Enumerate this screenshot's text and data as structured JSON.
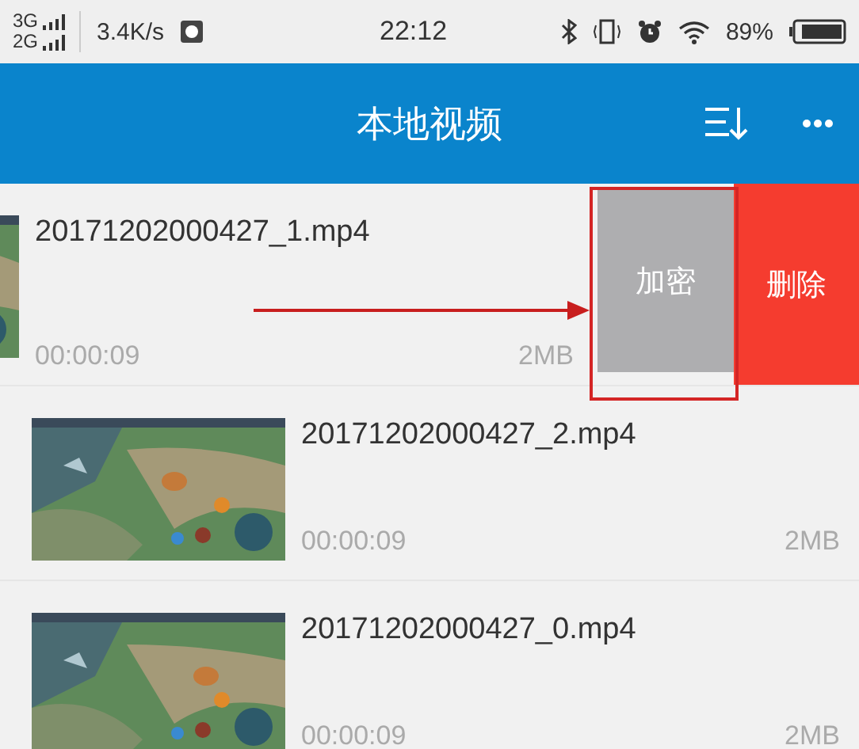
{
  "status_bar": {
    "networks": [
      "3G",
      "2G"
    ],
    "speed": "3.4K/s",
    "time": "22:12",
    "battery": "89%"
  },
  "app_bar": {
    "title": "本地视频"
  },
  "videos": [
    {
      "name": "20171202000427_1.mp4",
      "duration": "00:00:09",
      "size": "2MB",
      "swiped": true,
      "actions": [
        {
          "label": "加密",
          "kind": "encrypt"
        },
        {
          "label": "删除",
          "kind": "delete"
        }
      ]
    },
    {
      "name": "20171202000427_2.mp4",
      "duration": "00:00:09",
      "size": "2MB",
      "swiped": false
    },
    {
      "name": "20171202000427_0.mp4",
      "duration": "00:00:09",
      "size": "2MB",
      "swiped": false
    }
  ]
}
